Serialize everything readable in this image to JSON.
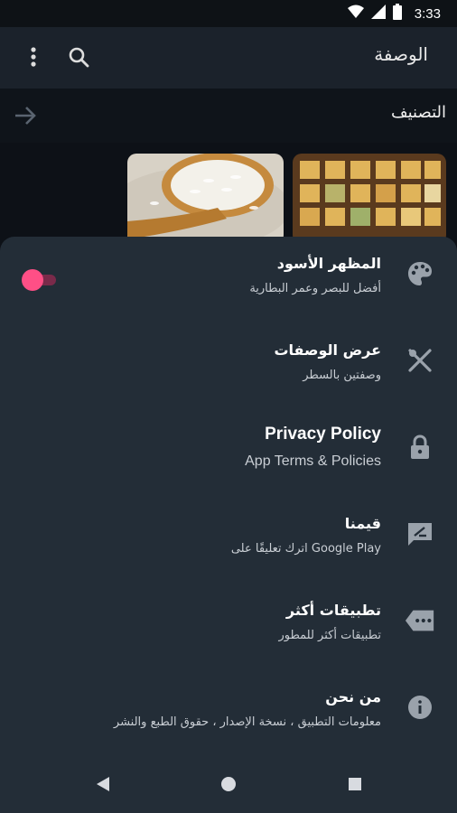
{
  "status": {
    "time": "3:33"
  },
  "toolbar": {
    "title": "الوصفة"
  },
  "section": {
    "title": "التصنيف"
  },
  "settings": {
    "dark_mode": {
      "title": "المظهر الأسود",
      "subtitle": "أفضل للبصر وعمر البطارية",
      "enabled": true
    },
    "recipes_view": {
      "title": "عرض الوصفات",
      "subtitle": "وصفتين بالسطر"
    },
    "privacy": {
      "title": "Privacy Policy",
      "subtitle": "App Terms & Policies"
    },
    "rate": {
      "title": "قيمنا",
      "subtitle": "اترك تعليقًا على Google Play"
    },
    "more_apps": {
      "title": "تطبيقات أكثر",
      "subtitle": "تطبيقات أكثر للمطور"
    },
    "about": {
      "title": "من نحن",
      "subtitle": "معلومات التطبيق ، نسخة الإصدار ، حقوق الطبع والنشر"
    }
  },
  "colors": {
    "accent": "#ff4f86",
    "sheet": "#232d37",
    "toolbar": "#1b222b"
  }
}
